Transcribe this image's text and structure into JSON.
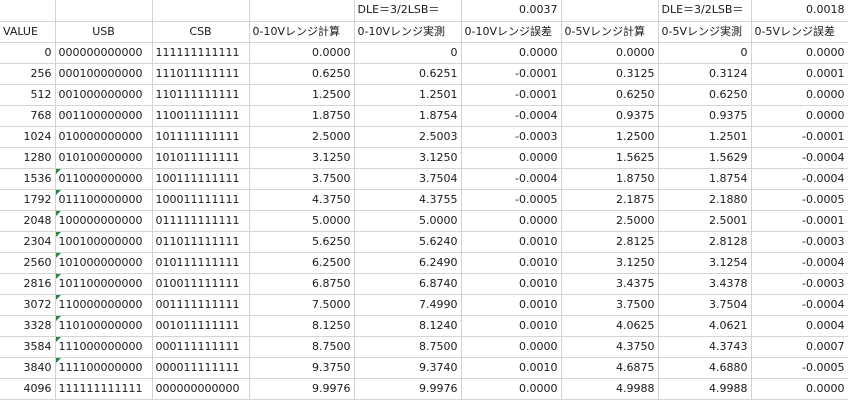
{
  "top_row": {
    "dle1_label": "DLE＝3/2LSB＝",
    "dle1_value": "0.0037",
    "dle2_label": "DLE＝3/2LSB＝",
    "dle2_value": "0.0018"
  },
  "headers": [
    "VALUE",
    "USB",
    "CSB",
    "0-10Vレンジ計算",
    "0-10Vレンジ実測",
    "0-10Vレンジ誤差",
    "0-5Vレンジ計算",
    "0-5Vレンジ実測",
    "0-5Vレンジ誤差"
  ],
  "rows": [
    [
      "0",
      "000000000000",
      "111111111111",
      "0.0000",
      "0",
      "0.0000",
      "0.0000",
      "0",
      "0.0000"
    ],
    [
      "256",
      "000100000000",
      "111011111111",
      "0.6250",
      "0.6251",
      "-0.0001",
      "0.3125",
      "0.3124",
      "0.0001"
    ],
    [
      "512",
      "001000000000",
      "110111111111",
      "1.2500",
      "1.2501",
      "-0.0001",
      "0.6250",
      "0.6250",
      "0.0000"
    ],
    [
      "768",
      "001100000000",
      "110011111111",
      "1.8750",
      "1.8754",
      "-0.0004",
      "0.9375",
      "0.9375",
      "0.0000"
    ],
    [
      "1024",
      "010000000000",
      "101111111111",
      "2.5000",
      "2.5003",
      "-0.0003",
      "1.2500",
      "1.2501",
      "-0.0001"
    ],
    [
      "1280",
      "010100000000",
      "101011111111",
      "3.1250",
      "3.1250",
      "0.0000",
      "1.5625",
      "1.5629",
      "-0.0004"
    ],
    [
      "1536",
      "011000000000",
      "100111111111",
      "3.7500",
      "3.7504",
      "-0.0004",
      "1.8750",
      "1.8754",
      "-0.0004"
    ],
    [
      "1792",
      "011100000000",
      "100011111111",
      "4.3750",
      "4.3755",
      "-0.0005",
      "2.1875",
      "2.1880",
      "-0.0005"
    ],
    [
      "2048",
      "100000000000",
      "011111111111",
      "5.0000",
      "5.0000",
      "0.0000",
      "2.5000",
      "2.5001",
      "-0.0001"
    ],
    [
      "2304",
      "100100000000",
      "011011111111",
      "5.6250",
      "5.6240",
      "0.0010",
      "2.8125",
      "2.8128",
      "-0.0003"
    ],
    [
      "2560",
      "101000000000",
      "010111111111",
      "6.2500",
      "6.2490",
      "0.0010",
      "3.1250",
      "3.1254",
      "-0.0004"
    ],
    [
      "2816",
      "101100000000",
      "010011111111",
      "6.8750",
      "6.8740",
      "0.0010",
      "3.4375",
      "3.4378",
      "-0.0003"
    ],
    [
      "3072",
      "110000000000",
      "001111111111",
      "7.5000",
      "7.4990",
      "0.0010",
      "3.7500",
      "3.7504",
      "-0.0004"
    ],
    [
      "3328",
      "110100000000",
      "001011111111",
      "8.1250",
      "8.1240",
      "0.0010",
      "4.0625",
      "4.0621",
      "0.0004"
    ],
    [
      "3584",
      "111000000000",
      "000111111111",
      "8.7500",
      "8.7500",
      "0.0000",
      "4.3750",
      "4.3743",
      "0.0007"
    ],
    [
      "3840",
      "111100000000",
      "000011111111",
      "9.3750",
      "9.3740",
      "0.0010",
      "4.6875",
      "4.6880",
      "-0.0005"
    ],
    [
      "4096",
      "111111111111",
      "000000000000",
      "9.9976",
      "9.9976",
      "0.0000",
      "4.9988",
      "4.9988",
      "0.0000"
    ]
  ],
  "error_marker_color": "#1e8a3c",
  "error_marker_rows": [
    6,
    7,
    8,
    9,
    10,
    11,
    12,
    13,
    14,
    15
  ]
}
